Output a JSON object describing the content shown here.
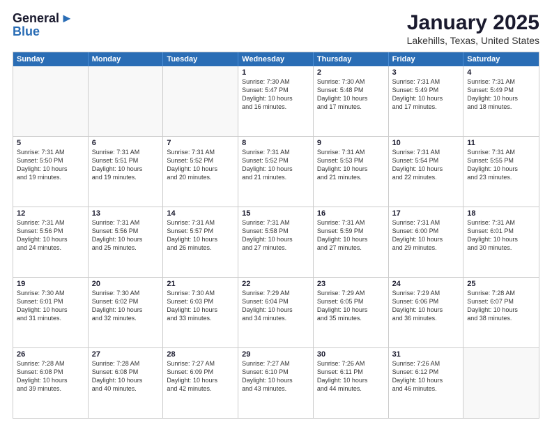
{
  "header": {
    "logo_line1": "General",
    "logo_line2": "Blue",
    "title": "January 2025",
    "subtitle": "Lakehills, Texas, United States"
  },
  "days_of_week": [
    "Sunday",
    "Monday",
    "Tuesday",
    "Wednesday",
    "Thursday",
    "Friday",
    "Saturday"
  ],
  "weeks": [
    [
      {
        "day": "",
        "info": ""
      },
      {
        "day": "",
        "info": ""
      },
      {
        "day": "",
        "info": ""
      },
      {
        "day": "1",
        "info": "Sunrise: 7:30 AM\nSunset: 5:47 PM\nDaylight: 10 hours\nand 16 minutes."
      },
      {
        "day": "2",
        "info": "Sunrise: 7:30 AM\nSunset: 5:48 PM\nDaylight: 10 hours\nand 17 minutes."
      },
      {
        "day": "3",
        "info": "Sunrise: 7:31 AM\nSunset: 5:49 PM\nDaylight: 10 hours\nand 17 minutes."
      },
      {
        "day": "4",
        "info": "Sunrise: 7:31 AM\nSunset: 5:49 PM\nDaylight: 10 hours\nand 18 minutes."
      }
    ],
    [
      {
        "day": "5",
        "info": "Sunrise: 7:31 AM\nSunset: 5:50 PM\nDaylight: 10 hours\nand 19 minutes."
      },
      {
        "day": "6",
        "info": "Sunrise: 7:31 AM\nSunset: 5:51 PM\nDaylight: 10 hours\nand 19 minutes."
      },
      {
        "day": "7",
        "info": "Sunrise: 7:31 AM\nSunset: 5:52 PM\nDaylight: 10 hours\nand 20 minutes."
      },
      {
        "day": "8",
        "info": "Sunrise: 7:31 AM\nSunset: 5:52 PM\nDaylight: 10 hours\nand 21 minutes."
      },
      {
        "day": "9",
        "info": "Sunrise: 7:31 AM\nSunset: 5:53 PM\nDaylight: 10 hours\nand 21 minutes."
      },
      {
        "day": "10",
        "info": "Sunrise: 7:31 AM\nSunset: 5:54 PM\nDaylight: 10 hours\nand 22 minutes."
      },
      {
        "day": "11",
        "info": "Sunrise: 7:31 AM\nSunset: 5:55 PM\nDaylight: 10 hours\nand 23 minutes."
      }
    ],
    [
      {
        "day": "12",
        "info": "Sunrise: 7:31 AM\nSunset: 5:56 PM\nDaylight: 10 hours\nand 24 minutes."
      },
      {
        "day": "13",
        "info": "Sunrise: 7:31 AM\nSunset: 5:56 PM\nDaylight: 10 hours\nand 25 minutes."
      },
      {
        "day": "14",
        "info": "Sunrise: 7:31 AM\nSunset: 5:57 PM\nDaylight: 10 hours\nand 26 minutes."
      },
      {
        "day": "15",
        "info": "Sunrise: 7:31 AM\nSunset: 5:58 PM\nDaylight: 10 hours\nand 27 minutes."
      },
      {
        "day": "16",
        "info": "Sunrise: 7:31 AM\nSunset: 5:59 PM\nDaylight: 10 hours\nand 27 minutes."
      },
      {
        "day": "17",
        "info": "Sunrise: 7:31 AM\nSunset: 6:00 PM\nDaylight: 10 hours\nand 29 minutes."
      },
      {
        "day": "18",
        "info": "Sunrise: 7:31 AM\nSunset: 6:01 PM\nDaylight: 10 hours\nand 30 minutes."
      }
    ],
    [
      {
        "day": "19",
        "info": "Sunrise: 7:30 AM\nSunset: 6:01 PM\nDaylight: 10 hours\nand 31 minutes."
      },
      {
        "day": "20",
        "info": "Sunrise: 7:30 AM\nSunset: 6:02 PM\nDaylight: 10 hours\nand 32 minutes."
      },
      {
        "day": "21",
        "info": "Sunrise: 7:30 AM\nSunset: 6:03 PM\nDaylight: 10 hours\nand 33 minutes."
      },
      {
        "day": "22",
        "info": "Sunrise: 7:29 AM\nSunset: 6:04 PM\nDaylight: 10 hours\nand 34 minutes."
      },
      {
        "day": "23",
        "info": "Sunrise: 7:29 AM\nSunset: 6:05 PM\nDaylight: 10 hours\nand 35 minutes."
      },
      {
        "day": "24",
        "info": "Sunrise: 7:29 AM\nSunset: 6:06 PM\nDaylight: 10 hours\nand 36 minutes."
      },
      {
        "day": "25",
        "info": "Sunrise: 7:28 AM\nSunset: 6:07 PM\nDaylight: 10 hours\nand 38 minutes."
      }
    ],
    [
      {
        "day": "26",
        "info": "Sunrise: 7:28 AM\nSunset: 6:08 PM\nDaylight: 10 hours\nand 39 minutes."
      },
      {
        "day": "27",
        "info": "Sunrise: 7:28 AM\nSunset: 6:08 PM\nDaylight: 10 hours\nand 40 minutes."
      },
      {
        "day": "28",
        "info": "Sunrise: 7:27 AM\nSunset: 6:09 PM\nDaylight: 10 hours\nand 42 minutes."
      },
      {
        "day": "29",
        "info": "Sunrise: 7:27 AM\nSunset: 6:10 PM\nDaylight: 10 hours\nand 43 minutes."
      },
      {
        "day": "30",
        "info": "Sunrise: 7:26 AM\nSunset: 6:11 PM\nDaylight: 10 hours\nand 44 minutes."
      },
      {
        "day": "31",
        "info": "Sunrise: 7:26 AM\nSunset: 6:12 PM\nDaylight: 10 hours\nand 46 minutes."
      },
      {
        "day": "",
        "info": ""
      }
    ]
  ]
}
